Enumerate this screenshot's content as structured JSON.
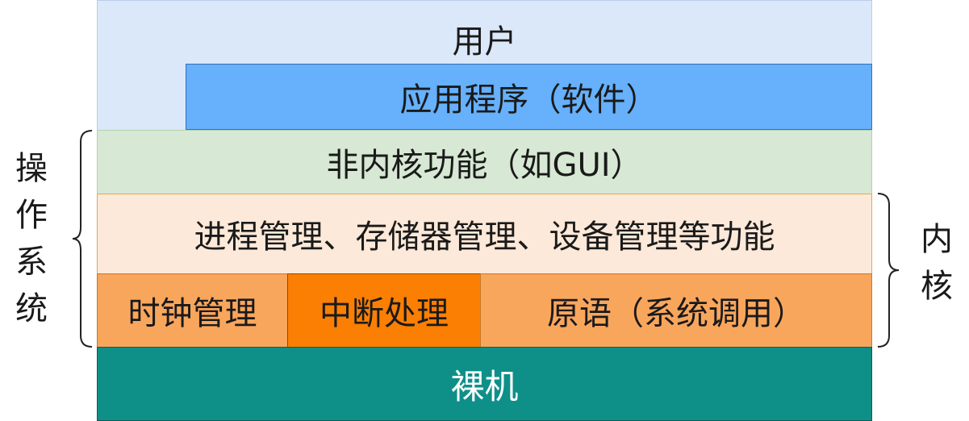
{
  "layers": {
    "user": "用户",
    "app": "应用程序（软件）",
    "nonkernel": "非内核功能（如GUI）",
    "kernel_services": "进程管理、存储器管理、设备管理等功能",
    "clock": "时钟管理",
    "interrupt": "中断处理",
    "primitive": "原语（系统调用）",
    "baremetal": "裸机"
  },
  "side_labels": {
    "os": "操作系统",
    "kernel": "内核"
  },
  "colors": {
    "user": "#dae8f9",
    "app": "#66b0fc",
    "nonkernel": "#d7e8d4",
    "kernel_services": "#fde9d9",
    "clock": "#f9a65d",
    "interrupt": "#fb7f03",
    "primitive": "#f9a65d",
    "baremetal": "#0e9089"
  }
}
